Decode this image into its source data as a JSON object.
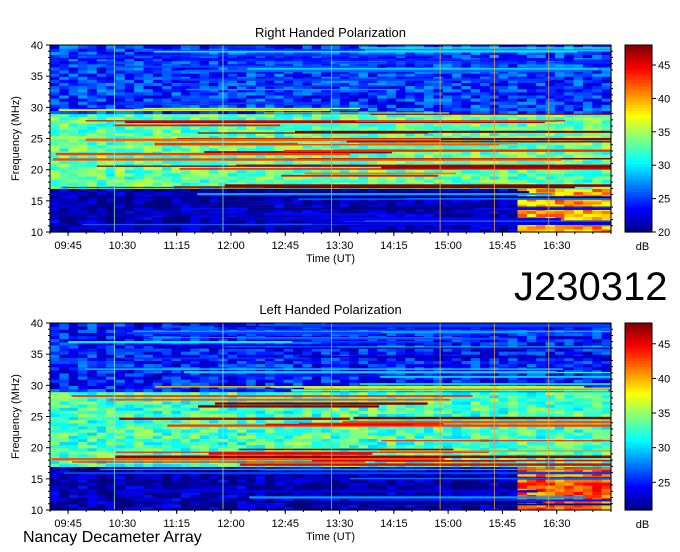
{
  "observation_id": "J230312",
  "footer": "Nancay Decameter Array",
  "chart_data": [
    {
      "type": "heatmap",
      "title": "Right Handed Polarization",
      "xlabel": "Time (UT)",
      "ylabel": "Frequency (MHz)",
      "xlim": [
        "09:30",
        "17:15"
      ],
      "ylim": [
        10,
        40
      ],
      "x_ticks": [
        "09:45",
        "10:30",
        "11:15",
        "12:00",
        "12:45",
        "13:30",
        "14:15",
        "15:00",
        "15:45",
        "16:30"
      ],
      "y_ticks": [
        10,
        15,
        20,
        25,
        30,
        35,
        40
      ],
      "colorbar": {
        "label": "dB",
        "min": 20,
        "max": 48,
        "ticks": [
          20,
          25,
          30,
          35,
          40,
          45
        ],
        "colormap": "jet"
      },
      "features": [
        {
          "freq_range": [
            10,
            17
          ],
          "time_range": [
            "09:30",
            "16:00"
          ],
          "level_db": 21
        },
        {
          "freq_range": [
            10,
            17
          ],
          "time_range": [
            "16:00",
            "17:15"
          ],
          "level_db": 40
        },
        {
          "freq_range": [
            17,
            29
          ],
          "time_range": [
            "09:30",
            "17:15"
          ],
          "level_db": 33
        },
        {
          "freq_range": [
            29,
            40
          ],
          "time_range": [
            "09:30",
            "17:15"
          ],
          "level_db": 25
        }
      ]
    },
    {
      "type": "heatmap",
      "title": "Left Handed Polarization",
      "xlabel": "Time (UT)",
      "ylabel": "Frequency (MHz)",
      "xlim": [
        "09:30",
        "17:15"
      ],
      "ylim": [
        10,
        40
      ],
      "x_ticks": [
        "09:45",
        "10:30",
        "11:15",
        "12:00",
        "12:45",
        "13:30",
        "14:15",
        "15:00",
        "15:45",
        "16:30"
      ],
      "y_ticks": [
        10,
        15,
        20,
        25,
        30,
        35,
        40
      ],
      "colorbar": {
        "label": "dB",
        "min": 21,
        "max": 48,
        "ticks": [
          25,
          30,
          35,
          40,
          45
        ],
        "colormap": "jet"
      },
      "features": [
        {
          "freq_range": [
            10,
            17
          ],
          "time_range": [
            "09:30",
            "16:00"
          ],
          "level_db": 22
        },
        {
          "freq_range": [
            10,
            17
          ],
          "time_range": [
            "16:00",
            "17:15"
          ],
          "level_db": 42
        },
        {
          "freq_range": [
            17,
            29
          ],
          "time_range": [
            "09:30",
            "17:15"
          ],
          "level_db": 33
        },
        {
          "freq_range": [
            29,
            40
          ],
          "time_range": [
            "09:30",
            "17:15"
          ],
          "level_db": 25
        }
      ]
    }
  ]
}
